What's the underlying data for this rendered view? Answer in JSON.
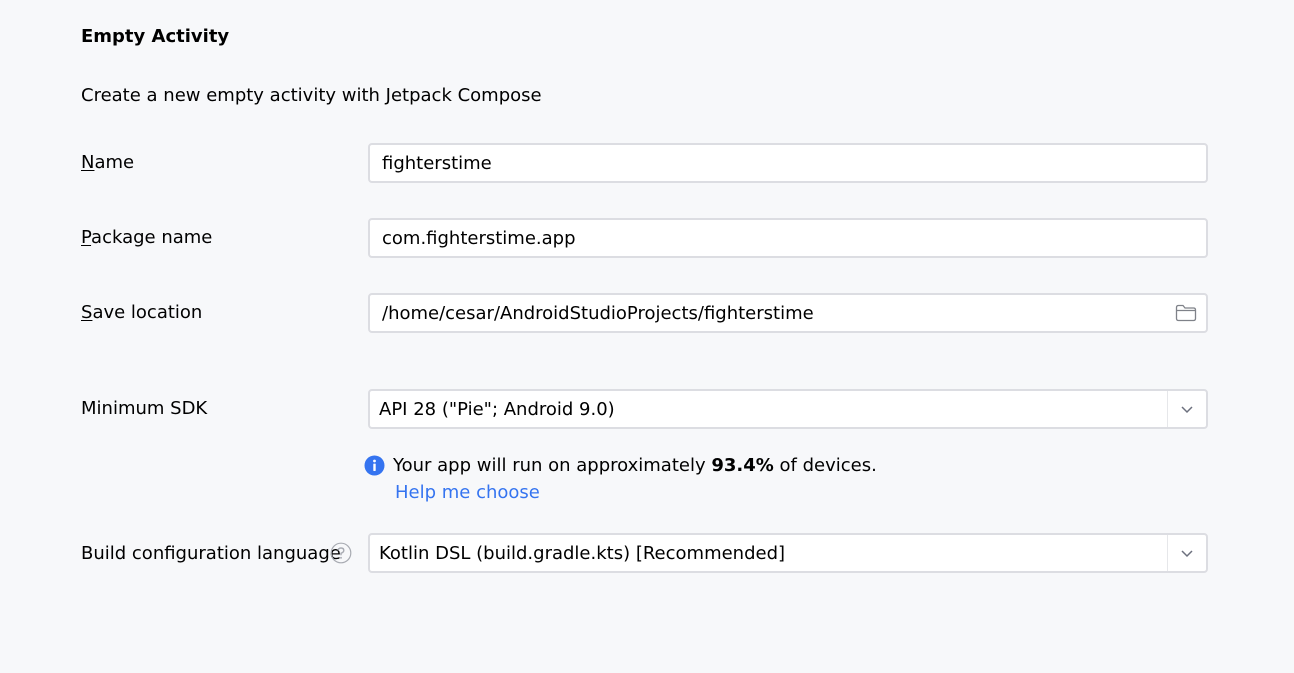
{
  "header": {
    "title": "Empty Activity",
    "description": "Create a new empty activity with Jetpack Compose"
  },
  "form": {
    "name": {
      "mnemonic": "N",
      "label_rest": "ame",
      "value": "fighterstime"
    },
    "package": {
      "mnemonic": "P",
      "label_rest": "ackage name",
      "value": "com.fighterstime.app"
    },
    "save_location": {
      "mnemonic": "S",
      "label_rest": "ave location",
      "value": "/home/cesar/AndroidStudioProjects/fighterstime",
      "browse_icon": "folder-icon"
    },
    "min_sdk": {
      "label": "Minimum SDK",
      "value": "API 28 (\"Pie\"; Android 9.0)",
      "dropdown_icon": "chevron-down-icon"
    },
    "sdk_info": {
      "icon": "info-icon",
      "text_before": "Your app will run on approximately ",
      "percentage": "93.4%",
      "text_after": " of devices.",
      "help_link": "Help me choose"
    },
    "build_config": {
      "label": "Build configuration language",
      "help_icon": "question-icon",
      "value": "Kotlin DSL (build.gradle.kts) [Recommended]",
      "dropdown_icon": "chevron-down-icon"
    }
  },
  "colors": {
    "background": "#f7f8fa",
    "link": "#3574f0",
    "info_icon": "#3574f0",
    "field_border": "#dcdde2"
  }
}
